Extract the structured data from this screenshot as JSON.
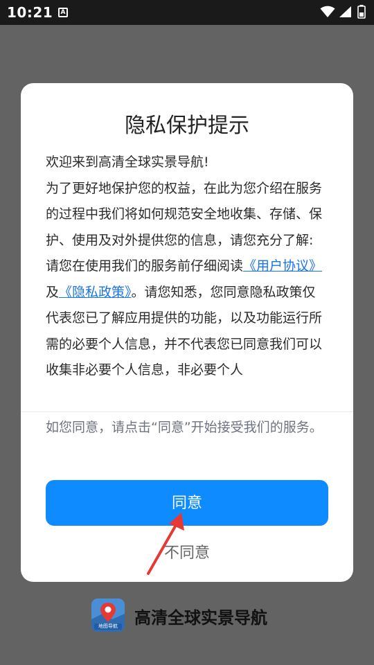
{
  "status_bar": {
    "time": "10:21",
    "notification_icon_letter": "A"
  },
  "dialog": {
    "title": "隐私保护提示",
    "body": {
      "welcome": "欢迎来到高清全球实景导航!",
      "intro": "为了更好地保护您的权益，在此为您介绍在服务的过程中我们将如何规范安全地收集、存储、保护、使用及对外提供您的信息，请您充分了解:",
      "read_prefix": "请您在使用我们的服务前仔细阅读",
      "user_agreement_link": "《用户协议》",
      "and": "及",
      "privacy_policy_link": "《隐私政策》",
      "read_suffix": "。请您知悉，您同意隐私政策仅代表您已了解应用提供的功能，以及功能运行所需的必要个人信息，并不代表您已同意我们可以收集非必要个人信息，非必要个人"
    },
    "notice": "如您同意，请点击“同意”开始接受我们的服务。",
    "agree_label": "同意",
    "disagree_label": "不同意"
  },
  "brand": {
    "logo_text": "地图导航",
    "app_name": "高清全球实景导航"
  },
  "colors": {
    "primary_button": "#0e8cff",
    "link": "#1a73e8",
    "arrow": "#e53935",
    "backdrop": "#636363"
  }
}
